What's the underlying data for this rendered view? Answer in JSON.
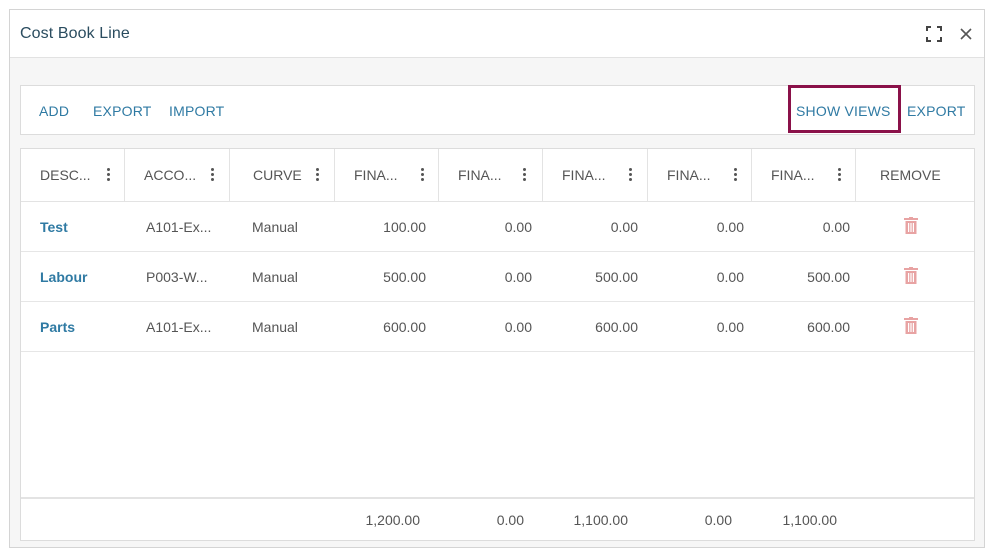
{
  "dialog": {
    "title": "Cost Book Line"
  },
  "toolbar": {
    "add": "ADD",
    "export_left": "EXPORT",
    "import": "IMPORT",
    "show_views": "SHOW VIEWS",
    "export_right": "EXPORT"
  },
  "grid": {
    "columns": [
      "DESC...",
      "ACCO...",
      "CURVE",
      "FINA...",
      "FINA...",
      "FINA...",
      "FINA...",
      "FINA...",
      "REMOVE"
    ],
    "rows": [
      {
        "desc": "Test",
        "account": "A101-Ex...",
        "curve": "Manual",
        "f1": "100.00",
        "f2": "0.00",
        "f3": "0.00",
        "f4": "0.00",
        "f5": "0.00"
      },
      {
        "desc": "Labour",
        "account": "P003-W...",
        "curve": "Manual",
        "f1": "500.00",
        "f2": "0.00",
        "f3": "500.00",
        "f4": "0.00",
        "f5": "500.00"
      },
      {
        "desc": "Parts",
        "account": "A101-Ex...",
        "curve": "Manual",
        "f1": "600.00",
        "f2": "0.00",
        "f3": "600.00",
        "f4": "0.00",
        "f5": "600.00"
      }
    ],
    "totals": {
      "f1": "1,200.00",
      "f2": "0.00",
      "f3": "1,100.00",
      "f4": "0.00",
      "f5": "1,100.00"
    }
  },
  "colors": {
    "accent": "#2f7aa3",
    "highlight": "#8a1149",
    "trash": "#e8a3a3"
  },
  "icons": {
    "expand": "expand-icon",
    "close": "close-icon",
    "column_menu": "kebab-icon",
    "remove": "trash-icon"
  }
}
